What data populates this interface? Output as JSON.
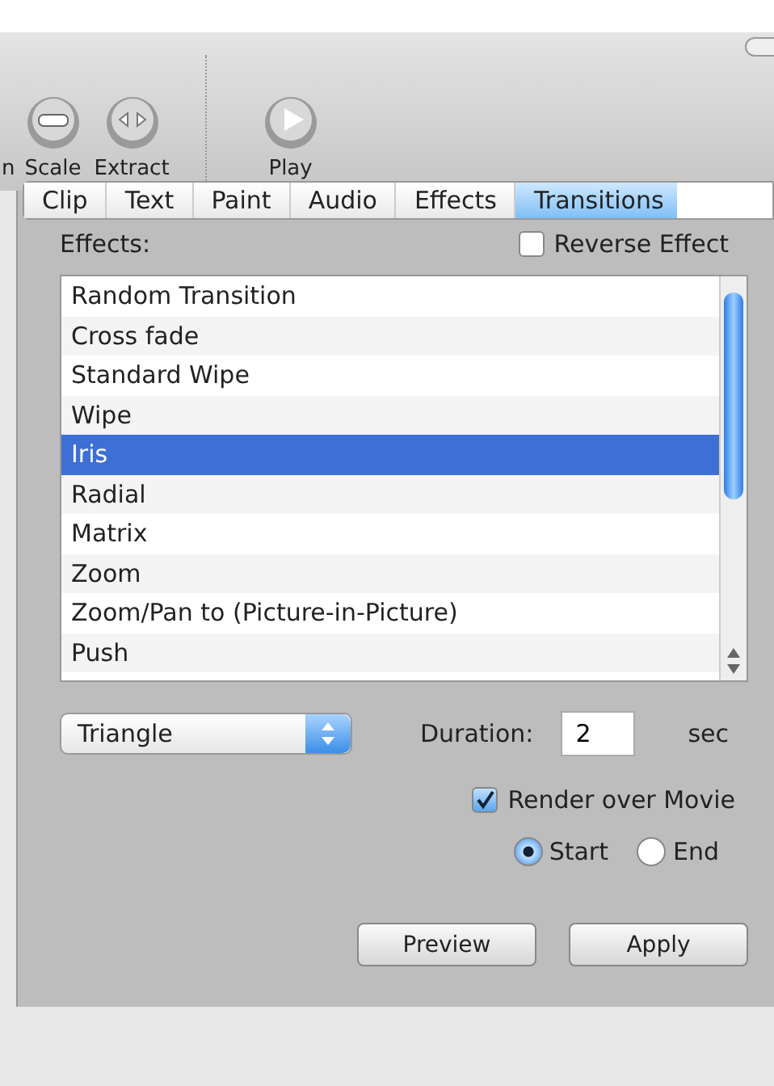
{
  "toolbar": {
    "buttons": [
      {
        "label": "n",
        "kind": "cut"
      },
      {
        "label": "Scale",
        "kind": "scale"
      },
      {
        "label": "Extract",
        "kind": "extract"
      },
      {
        "label": "Play",
        "kind": "play"
      }
    ]
  },
  "tabs": [
    {
      "label": "Clip",
      "selected": false
    },
    {
      "label": "Text",
      "selected": false
    },
    {
      "label": "Paint",
      "selected": false
    },
    {
      "label": "Audio",
      "selected": false
    },
    {
      "label": "Effects",
      "selected": false
    },
    {
      "label": "Transitions",
      "selected": true
    }
  ],
  "effects_label": "Effects:",
  "reverse_effect": {
    "label": "Reverse Effect",
    "checked": false
  },
  "effects": [
    {
      "label": "Random Transition",
      "selected": false
    },
    {
      "label": "Cross fade",
      "selected": false
    },
    {
      "label": "Standard Wipe",
      "selected": false
    },
    {
      "label": "Wipe",
      "selected": false
    },
    {
      "label": "Iris",
      "selected": true
    },
    {
      "label": "Radial",
      "selected": false
    },
    {
      "label": "Matrix",
      "selected": false
    },
    {
      "label": "Zoom",
      "selected": false
    },
    {
      "label": "Zoom/Pan to (Picture-in-Picture)",
      "selected": false
    },
    {
      "label": "Push",
      "selected": false
    }
  ],
  "shape_popup": {
    "value": "Triangle"
  },
  "duration": {
    "label": "Duration:",
    "value": "2",
    "unit": "sec"
  },
  "render_over_movie": {
    "label": "Render over Movie",
    "checked": true
  },
  "position": [
    {
      "label": "Start",
      "selected": true
    },
    {
      "label": "End",
      "selected": false
    }
  ],
  "buttons": [
    "Preview",
    "Apply"
  ]
}
